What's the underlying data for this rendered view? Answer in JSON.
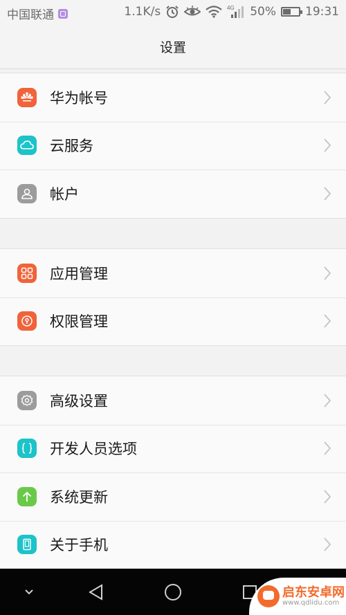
{
  "status_bar": {
    "carrier": "中国联通",
    "speed": "1.1K/s",
    "network_type": "4G",
    "battery": "50%",
    "battery_level": 0.5,
    "time": "19:31",
    "icons": [
      "sim-icon",
      "alarm-icon",
      "eye-icon",
      "wifi-icon",
      "signal-icon",
      "battery-icon"
    ]
  },
  "header": {
    "title": "设置"
  },
  "groups": [
    {
      "items": [
        {
          "label": "华为帐号",
          "icon": "huawei-icon",
          "color": "#f0633b"
        },
        {
          "label": "云服务",
          "icon": "cloud-icon",
          "color": "#1cc3c9"
        },
        {
          "label": "帐户",
          "icon": "account-icon",
          "color": "#9c9c9c"
        }
      ]
    },
    {
      "items": [
        {
          "label": "应用管理",
          "icon": "apps-icon",
          "color": "#f0633b"
        },
        {
          "label": "权限管理",
          "icon": "permission-icon",
          "color": "#f0633b"
        }
      ]
    },
    {
      "items": [
        {
          "label": "高级设置",
          "icon": "gear-icon",
          "color": "#9c9c9c"
        },
        {
          "label": "开发人员选项",
          "icon": "braces-icon",
          "color": "#1cc3c9"
        },
        {
          "label": "系统更新",
          "icon": "update-icon",
          "color": "#6bc94a"
        },
        {
          "label": "关于手机",
          "icon": "phone-icon",
          "color": "#1cc3c9"
        }
      ]
    }
  ],
  "nav_bar": {
    "buttons": [
      "collapse-icon",
      "back-icon",
      "home-icon",
      "recents-icon"
    ]
  },
  "watermark": {
    "name": "启东安卓网",
    "url": "www.qdlidu.com"
  }
}
